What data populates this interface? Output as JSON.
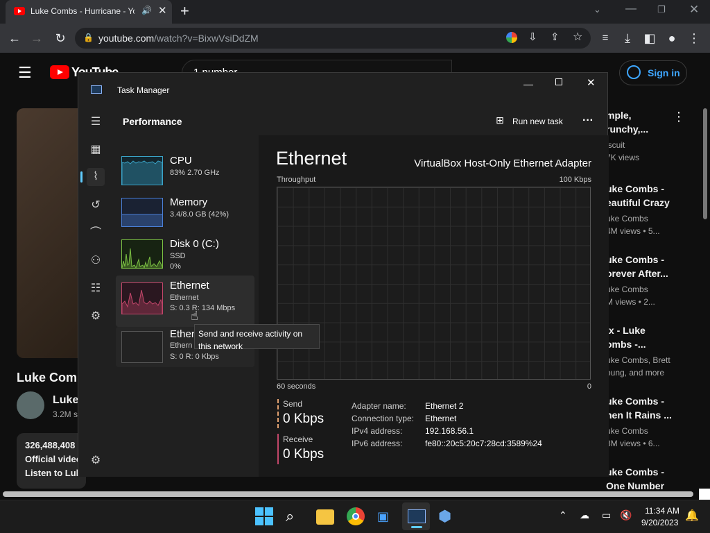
{
  "browser": {
    "tab_title": "Luke Combs - Hurricane - Yo",
    "url_domain": "youtube.com",
    "url_path": "/watch?v=BixwVsiDdZM",
    "new_tab": "+"
  },
  "youtube": {
    "logo_text": "YouTube",
    "search_value": "1 number",
    "sign_in": "Sign in",
    "video_title": "Luke Comb",
    "channel_name": "Luke",
    "subscribers": "3.2M s",
    "views_count": "326,488,408",
    "desc_line1": "Official video",
    "desc_line2": "Listen to Luk",
    "related": [
      {
        "t1": "mple,",
        "t2": "runchy,...",
        "s1": "iscuit",
        "s2": "7K views"
      },
      {
        "t1": "uke Combs -",
        "t2": "eautiful Crazy",
        "s1": "uke Combs",
        "s2": "4M views • 5..."
      },
      {
        "t1": "uke Combs -",
        "t2": "orever After...",
        "s1": "uke Combs",
        "s2": "M views • 2..."
      },
      {
        "t1": "ix - Luke",
        "t2": "ombs -...",
        "s1": "uke Combs, Brett",
        "s2": "oung, and more"
      },
      {
        "t1": "uke Combs -",
        "t2": "hen It Rains ...",
        "s1": "uke Combs",
        "s2": "3M views • 6..."
      },
      {
        "t1": "uke Combs -",
        "t2": "One Number",
        "s1": "",
        "s2": ""
      }
    ]
  },
  "taskmanager": {
    "title": "Task Manager",
    "section": "Performance",
    "run_new_task": "Run new task",
    "more": "···",
    "items": [
      {
        "name": "CPU",
        "sub1": "83%  2.70 GHz",
        "sub2": "",
        "color": "#3aa3c7"
      },
      {
        "name": "Memory",
        "sub1": "3.4/8.0 GB (42%)",
        "sub2": "",
        "color": "#4a7fd6"
      },
      {
        "name": "Disk 0 (C:)",
        "sub1": "SSD",
        "sub2": "0%",
        "color": "#7bc043"
      },
      {
        "name": "Ethernet",
        "sub1": "Ethernet",
        "sub2": "S: 0.3  R: 134 Mbps",
        "color": "#c2466a"
      },
      {
        "name": "Ethernet",
        "sub1": "Ethern",
        "sub2": "S: 0 R: 0 Kbps",
        "color": "#888888"
      }
    ],
    "tooltip": "Send and receive activity on this network",
    "detail": {
      "heading": "Ethernet",
      "adapter": "VirtualBox Host-Only Ethernet Adapter",
      "throughput": "Throughput",
      "max": "100 Kbps",
      "time_label": "60 seconds",
      "zero": "0",
      "send_label": "Send",
      "send_value": "0 Kbps",
      "receive_label": "Receive",
      "receive_value": "0 Kbps",
      "props": [
        {
          "k": "Adapter name:",
          "v": "Ethernet 2"
        },
        {
          "k": "Connection type:",
          "v": "Ethernet"
        },
        {
          "k": "IPv4 address:",
          "v": "192.168.56.1"
        },
        {
          "k": "IPv6 address:",
          "v": "fe80::20c5:20c7:28cd:3589%24"
        }
      ]
    }
  },
  "taskbar": {
    "time": "11:34 AM",
    "date": "9/20/2023"
  },
  "colors": {
    "youtube_red": "#ff0000",
    "send_color": "#e0a070",
    "receive_color": "#c2466a",
    "accent_blue": "#3ea6ff"
  }
}
